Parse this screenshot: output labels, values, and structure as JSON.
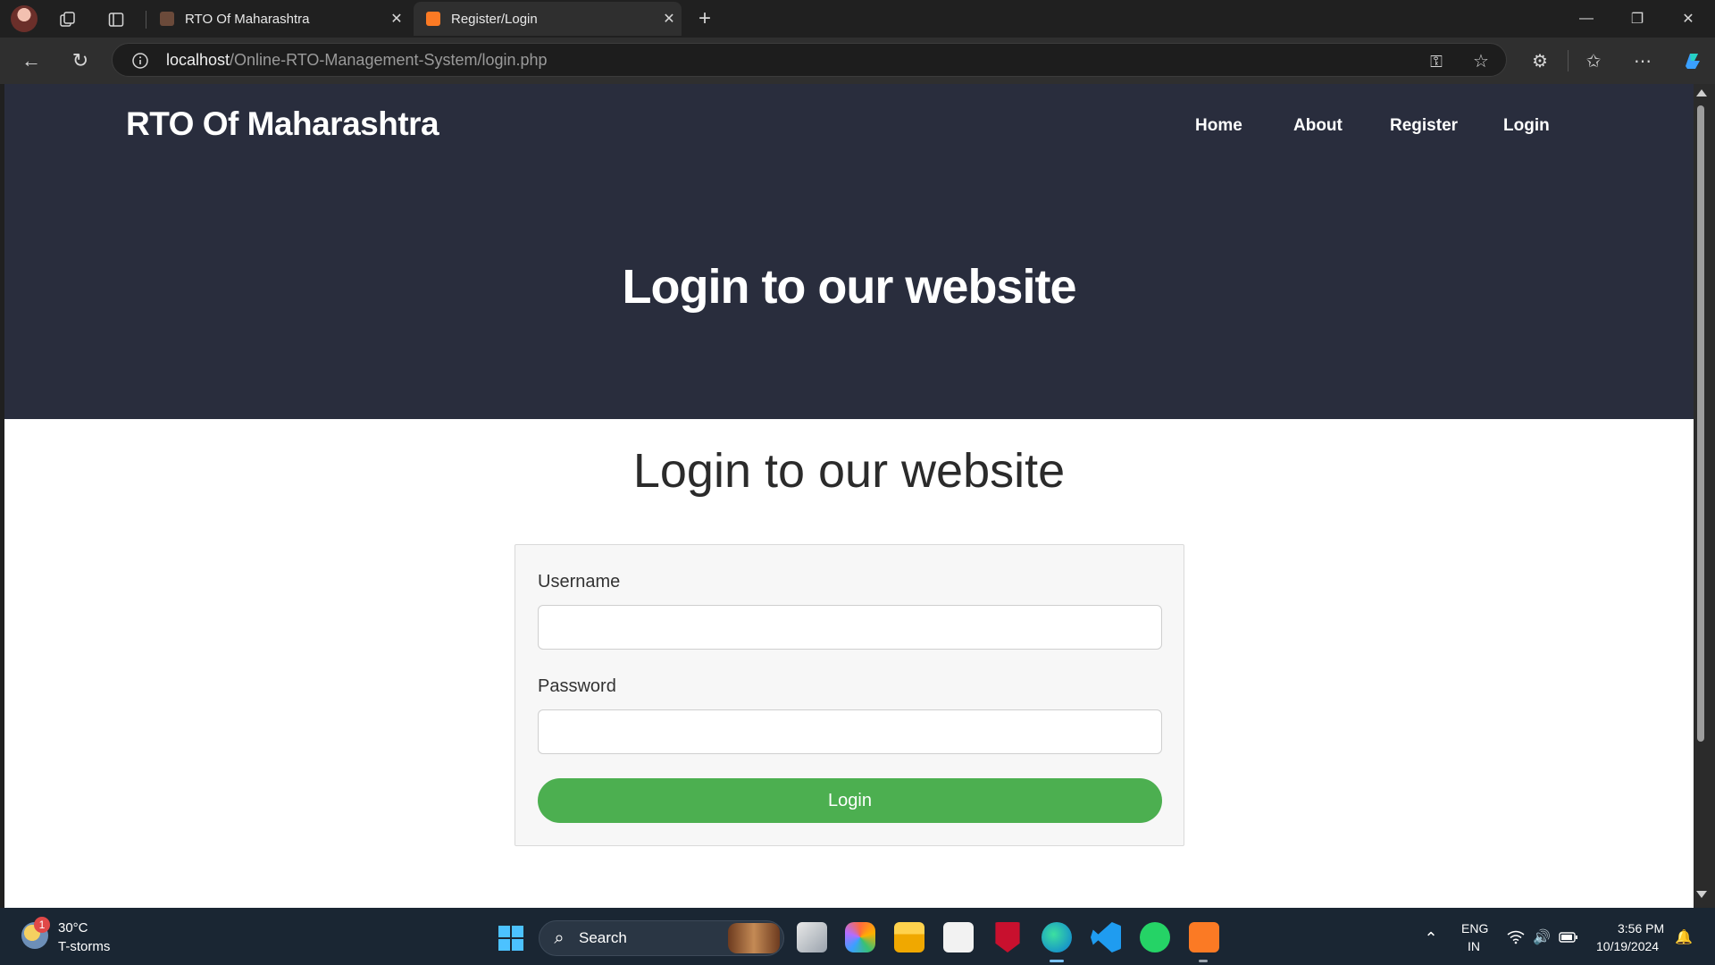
{
  "browser": {
    "tabs": [
      {
        "title": "RTO Of Maharashtra",
        "active": false
      },
      {
        "title": "Register/Login",
        "active": true
      }
    ],
    "url_host": "localhost",
    "url_path": "/Online-RTO-Management-System/login.php"
  },
  "site": {
    "brand": "RTO Of Maharashtra",
    "nav": [
      "Home",
      "About",
      "Register",
      "Login"
    ],
    "hero_title": "Login to our website",
    "section_title": "Login to our website"
  },
  "form": {
    "username_label": "Username",
    "username_value": "",
    "password_label": "Password",
    "password_value": "",
    "submit_label": "Login"
  },
  "taskbar": {
    "weather_temp": "30°C",
    "weather_desc": "T-storms",
    "weather_badge": "1",
    "search_label": "Search",
    "lang": "ENG",
    "region": "IN",
    "time": "3:56 PM",
    "date": "10/19/2024"
  },
  "colors": {
    "hero_bg": "#292d3d",
    "button_bg": "#4caf50",
    "card_bg": "#f7f7f7"
  }
}
